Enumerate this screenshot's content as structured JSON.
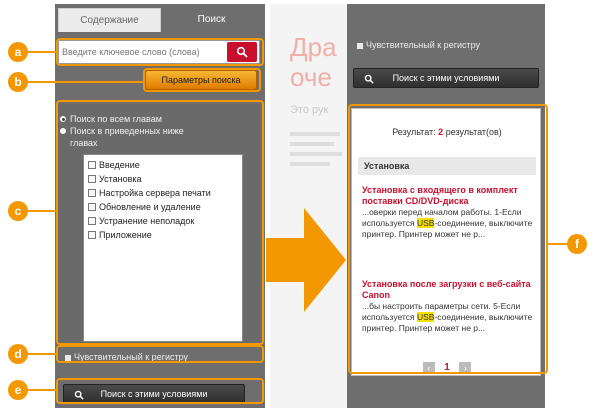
{
  "tabs": {
    "contents": "Содержание",
    "search": "Поиск"
  },
  "search": {
    "placeholder": "Введите ключевое слово (слова)"
  },
  "options_button": "Параметры поиска",
  "scope": {
    "all": "Поиск по всем главам",
    "selected_line1": "Поиск в приведенных ниже",
    "selected_line2": "главах"
  },
  "chapters": [
    "Введение",
    "Установка",
    "Настройка сервера печати",
    "Обновление и удаление",
    "Устранение неполадок",
    "Приложение"
  ],
  "case_sensitive": "Чувствительный к регистру",
  "search_conditions_button": "Поиск с этими условиями",
  "middle": {
    "title_line1": "Дра",
    "title_line2": "оче",
    "sub": "Это рук"
  },
  "results": {
    "label": "Результат:",
    "count": "2",
    "suffix": "результат(ов)",
    "section": "Установка",
    "items": [
      {
        "title": "Установка с входящего в комплект поставки CD/DVD-диска",
        "snip_before": "...оверки перед началом работы. 1-Если используется ",
        "hl": "USB",
        "snip_after": "-соединение, выключите принтер. Принтер может не р..."
      },
      {
        "title": "Установка после загрузки с веб-сайта Canon",
        "snip_before": "...бы настроить параметры сети. 5-Если используется ",
        "hl": "USB",
        "snip_after": "-соединение, выключите принтер. Принтер может не р..."
      }
    ],
    "page": "1"
  },
  "callouts": [
    "a",
    "b",
    "c",
    "d",
    "e",
    "f"
  ],
  "colors": {
    "accent": "#f39800",
    "brand_red": "#c8102e",
    "panel": "#6e6e6e"
  }
}
